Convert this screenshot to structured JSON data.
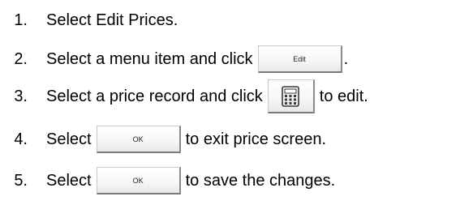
{
  "steps": [
    {
      "number": "1.",
      "text_before": "Select Edit Prices."
    },
    {
      "number": "2.",
      "text_before": "Select a menu item and click",
      "button_label": "Edit",
      "text_after": "."
    },
    {
      "number": "3.",
      "text_before": "Select a price record and click",
      "button_icon": "calculator-icon",
      "text_after": "to edit."
    },
    {
      "number": "4.",
      "text_before": "Select",
      "button_label": "OK",
      "text_after": "to exit price screen."
    },
    {
      "number": "5.",
      "text_before": "Select",
      "button_label": "OK",
      "text_after": "to save the changes."
    }
  ]
}
